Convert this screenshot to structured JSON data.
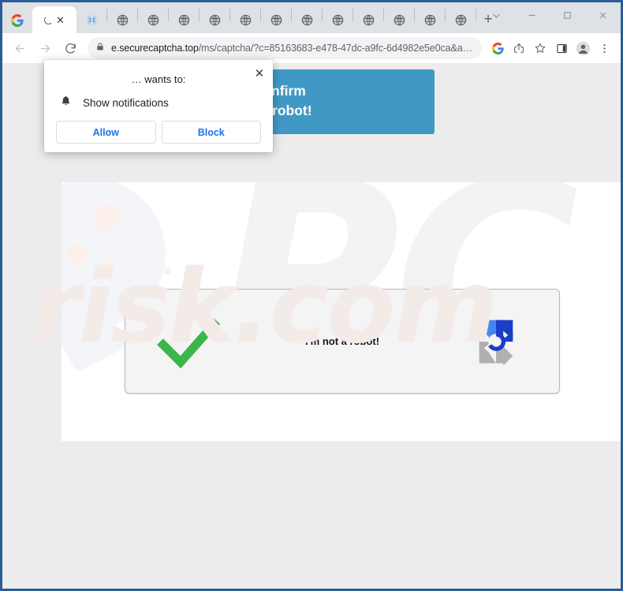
{
  "window": {
    "controls": [
      {
        "name": "tab-search",
        "glyph": "chevron-down"
      },
      {
        "name": "minimize",
        "glyph": "minimize"
      },
      {
        "name": "maximize",
        "glyph": "maximize"
      },
      {
        "name": "close",
        "glyph": "close"
      }
    ]
  },
  "tabs": {
    "first_tab_icon": "google-icon",
    "active_tab": {
      "title": "",
      "loading": true,
      "close_label": "✕"
    },
    "second_icon_tab": "blue-favicon",
    "globe_tab_count": 12,
    "globe_icon_name": "globe-icon",
    "new_tab_label": "+"
  },
  "toolbar": {
    "back_label": "Back",
    "forward_label": "Forward",
    "reload_label": "Reload",
    "url_secure_part": "e.securecaptcha.top",
    "url_path_part": "/ms/captcha/?c=85163683-e478-47dc-a9fc-6d4982e5e0ca&a…",
    "url_full": "e.securecaptcha.top/ms/captcha/?c=85163683-e478-47dc-a9fc-6d4982e5e0ca&a…",
    "lock_icon": "lock-icon",
    "right_icons": [
      {
        "name": "google-lens-icon",
        "label": "G"
      },
      {
        "name": "share-icon",
        "label": "Share"
      },
      {
        "name": "bookmark-star-icon",
        "label": "Bookmark"
      },
      {
        "name": "side-panel-icon",
        "label": "Side panel"
      },
      {
        "name": "profile-avatar-icon",
        "label": "Profile"
      },
      {
        "name": "more-menu-icon",
        "label": "Customize and control"
      }
    ]
  },
  "page": {
    "promo_banner": {
      "line1": "Allow» to confirm",
      "line2": "ou are not a robot!",
      "background": "#4099c4",
      "text_color": "#ffffff"
    },
    "captcha": {
      "label": "I'm not a robot!",
      "checkmark_color": "#3cb54a",
      "logo_name": "recaptcha-logo-icon",
      "logo_colors": {
        "light_blue": "#4285f4",
        "dark_blue": "#1a3ec8",
        "grey": "#b0b0b0"
      }
    },
    "watermark_top": "PC",
    "watermark_bottom": "risk.com"
  },
  "notification_popup": {
    "title": "… wants to:",
    "permission_label": "Show notifications",
    "bell_icon": "bell-icon",
    "close_label": "✕",
    "allow_label": "Allow",
    "block_label": "Block",
    "button_text_color": "#1a73e8"
  }
}
